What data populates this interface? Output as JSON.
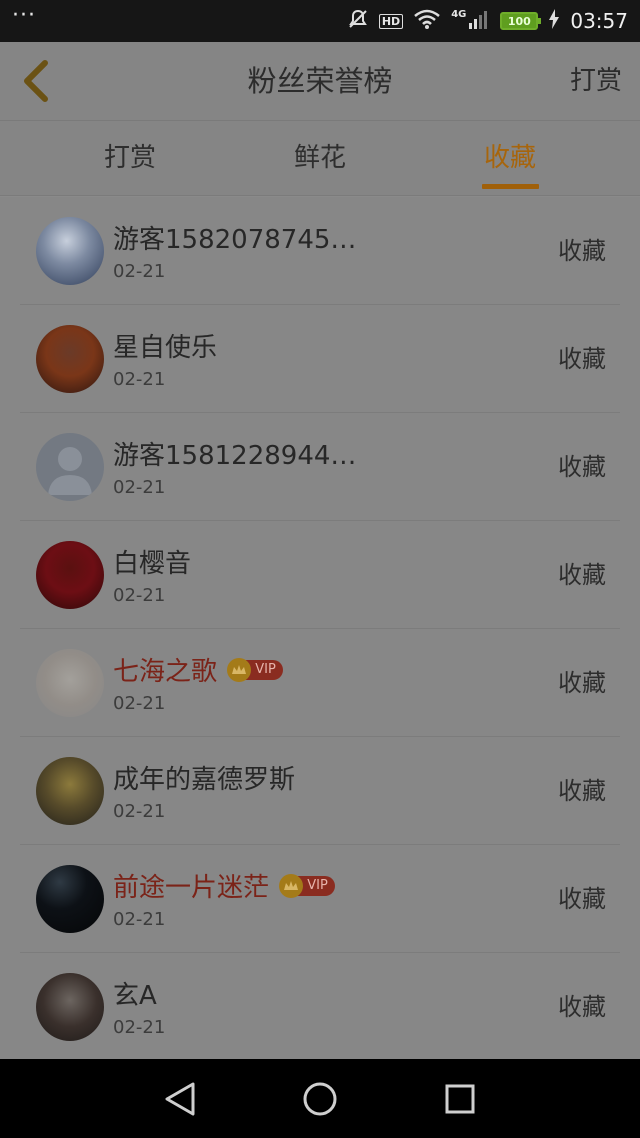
{
  "status": {
    "dots": "···",
    "hd": "HD",
    "network": "4G",
    "battery": "100",
    "time": "03:57"
  },
  "header": {
    "title": "粉丝荣誉榜",
    "right_link": "打赏"
  },
  "tabs": [
    "打赏",
    "鲜花",
    "收藏"
  ],
  "vip_label": "VIP",
  "rows": [
    {
      "name": "游客1582078745…",
      "date": "02-21",
      "action": "收藏",
      "vip": false
    },
    {
      "name": "星自使乐",
      "date": "02-21",
      "action": "收藏",
      "vip": false
    },
    {
      "name": "游客1581228944…",
      "date": "02-21",
      "action": "收藏",
      "vip": false
    },
    {
      "name": "白樱音",
      "date": "02-21",
      "action": "收藏",
      "vip": false
    },
    {
      "name": "七海之歌",
      "date": "02-21",
      "action": "收藏",
      "vip": true
    },
    {
      "name": "成年的嘉德罗斯",
      "date": "02-21",
      "action": "收藏",
      "vip": false
    },
    {
      "name": "前途一片迷茫",
      "date": "02-21",
      "action": "收藏",
      "vip": true
    },
    {
      "name": "玄A",
      "date": "02-21",
      "action": "收藏",
      "vip": false
    }
  ],
  "colors": {
    "accent": "#a7650c",
    "vip_name": "#7b2318"
  }
}
